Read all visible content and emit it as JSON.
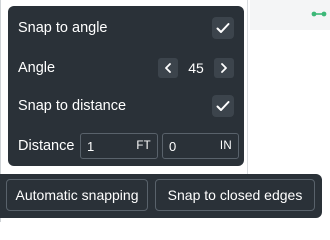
{
  "snapping_panel": {
    "snap_to_angle": {
      "label": "Snap to angle",
      "checked": true
    },
    "angle": {
      "label": "Angle",
      "value": "45"
    },
    "snap_to_distance": {
      "label": "Snap to distance",
      "checked": true
    },
    "distance": {
      "label": "Distance",
      "feet_value": "1",
      "feet_unit": "FT",
      "inches_value": "0",
      "inches_unit": "IN"
    }
  },
  "snap_bar": {
    "automatic_label": "Automatic snapping",
    "closed_edges_label": "Snap to closed edges"
  },
  "icons": [
    "check-icon",
    "chevron-left-icon",
    "chevron-right-icon",
    "node-connector-icon"
  ],
  "colors": {
    "panel_bg": "#2a3138",
    "control_bg": "#3c444c",
    "border": "#59626b",
    "node_accent": "#3cb878"
  }
}
